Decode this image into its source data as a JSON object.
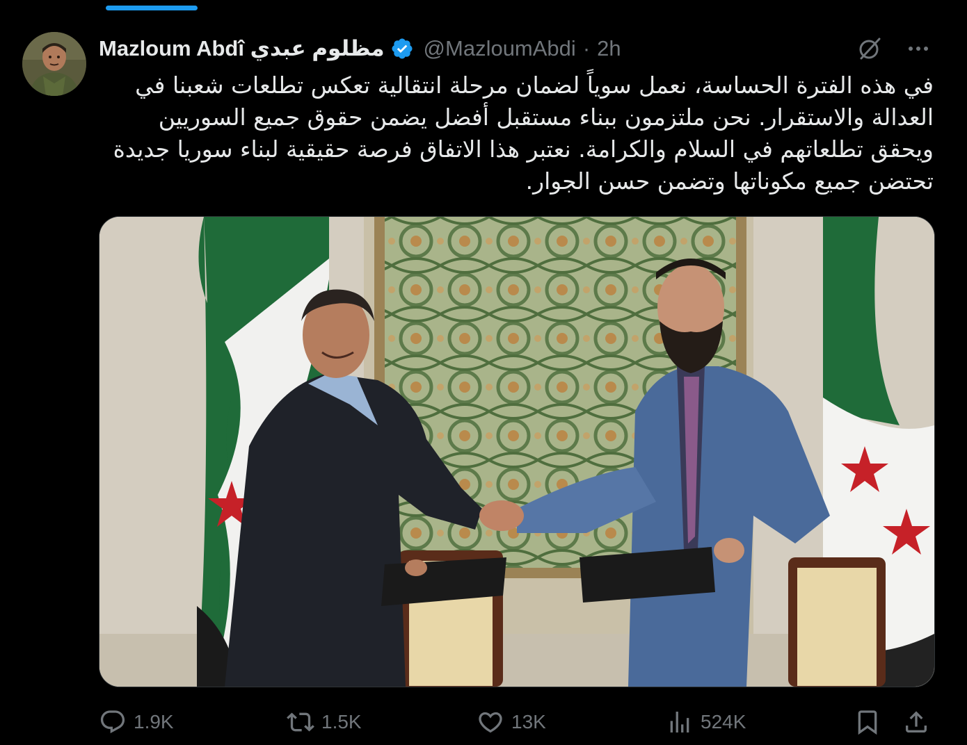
{
  "tweet": {
    "author_name": "Mazloum Abdî مظلوم عبدي",
    "handle": "@MazloumAbdi",
    "separator": "·",
    "time": "2h",
    "verified_color": "#1d9bf0",
    "text": "في هذه الفترة الحساسة، نعمل سوياً لضمان مرحلة انتقالية تعكس تطلعات شعبنا في العدالة والاستقرار. نحن ملتزمون ببناء مستقبل أفضل يضمن حقوق جميع السوريين ويحقق تطلعاتهم في السلام والكرامة. نعتبر هذا الاتفاق فرصة حقيقية لبناء سوريا جديدة تحتضن جميع مكوناتها وتضمن حسن الجوار.",
    "header_icons": [
      "grok-icon",
      "more-icon"
    ],
    "media_icon": "photo-handshake"
  },
  "metrics": {
    "replies": "1.9K",
    "reposts": "1.5K",
    "likes": "13K",
    "views": "524K"
  },
  "action_icons": [
    "reply-icon",
    "repost-icon",
    "like-icon",
    "views-icon",
    "bookmark-icon",
    "share-icon"
  ],
  "colors": {
    "background": "#000000",
    "text": "#e7e9ea",
    "muted": "#71767b",
    "accent": "#1d9bf0"
  }
}
